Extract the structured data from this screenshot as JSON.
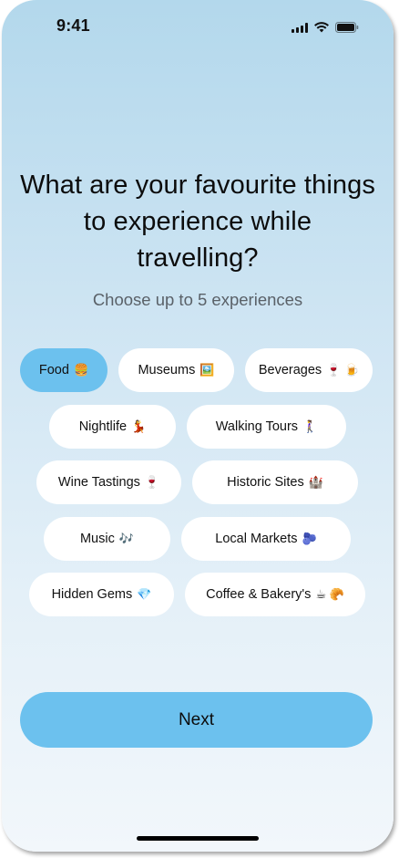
{
  "status_bar": {
    "time": "9:41",
    "icons": [
      "cellular-signal-icon",
      "wifi-icon",
      "battery-icon"
    ]
  },
  "title": "What are your favourite things to experience while travelling?",
  "subtitle": "Choose up to 5 experiences",
  "experiences": [
    {
      "label": "Food",
      "emoji": "🍔",
      "selected": true
    },
    {
      "label": "Museums",
      "emoji": "🖼️",
      "selected": false
    },
    {
      "label": "Beverages",
      "emoji": "🍷 🍺",
      "selected": false
    },
    {
      "label": "Nightlife",
      "emoji": "💃",
      "selected": false
    },
    {
      "label": "Walking Tours",
      "emoji": "🚶‍♀️",
      "selected": false
    },
    {
      "label": "Wine Tastings",
      "emoji": "🍷",
      "selected": false
    },
    {
      "label": "Historic Sites",
      "emoji": "🏰",
      "selected": false
    },
    {
      "label": "Music",
      "emoji": "🎶",
      "selected": false
    },
    {
      "label": "Local Markets",
      "emoji": "🫐",
      "selected": false
    },
    {
      "label": "Hidden Gems",
      "emoji": "💎",
      "selected": false
    },
    {
      "label": "Coffee & Bakery's",
      "emoji": "☕ 🥐",
      "selected": false
    }
  ],
  "next_button": {
    "label": "Next"
  },
  "colors": {
    "accent": "#6cc1ee",
    "background_top": "#b3d8ec",
    "background_bottom": "#f2f7fb",
    "chip": "#ffffff",
    "subtitle": "#5a6168"
  }
}
